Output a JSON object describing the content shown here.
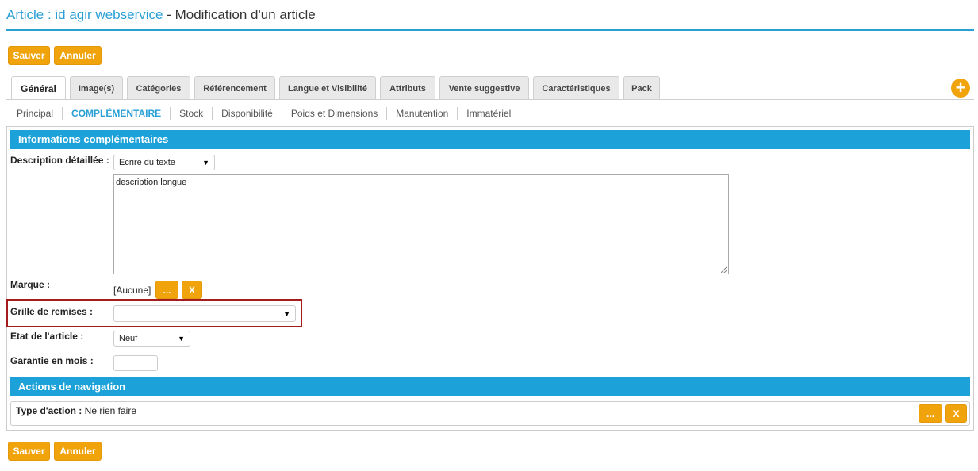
{
  "header": {
    "crumb": "Article : id agir webservice",
    "separator": " - ",
    "page_title": "Modification d'un article"
  },
  "toolbar": {
    "save_label": "Sauver",
    "cancel_label": "Annuler"
  },
  "tabs": [
    {
      "label": "Général",
      "active": true
    },
    {
      "label": "Image(s)"
    },
    {
      "label": "Catégories"
    },
    {
      "label": "Référencement"
    },
    {
      "label": "Langue et Visibilité"
    },
    {
      "label": "Attributs"
    },
    {
      "label": "Vente suggestive"
    },
    {
      "label": "Caractéristiques"
    },
    {
      "label": "Pack"
    }
  ],
  "add_icon": "plus-circle-icon",
  "subtabs": [
    {
      "label": "Principal"
    },
    {
      "label": "COMPLÉMENTAIRE",
      "active": true
    },
    {
      "label": "Stock"
    },
    {
      "label": "Disponibilité"
    },
    {
      "label": "Poids et Dimensions"
    },
    {
      "label": "Manutention"
    },
    {
      "label": "Immatériel"
    }
  ],
  "info_section": {
    "title": "Informations complémentaires",
    "description_label": "Description détaillée :",
    "description_mode": "Ecrire du texte",
    "description_text": "description longue",
    "brand_label": "Marque :",
    "brand_value": "[Aucune]",
    "browse_button": "...",
    "clear_button": "X",
    "discount_label": "Grille de remises :",
    "discount_value": "",
    "state_label": "Etat de l'article :",
    "state_value": "Neuf",
    "warranty_label": "Garantie en mois :",
    "warranty_value": ""
  },
  "nav_section": {
    "title": "Actions de navigation",
    "action_type_label": "Type d'action :",
    "action_type_value": "Ne rien faire",
    "browse_button": "...",
    "clear_button": "X"
  },
  "colors": {
    "accent_blue": "#1ca2d8",
    "button_orange": "#f0a30a",
    "highlight_red": "#a51c1c"
  }
}
